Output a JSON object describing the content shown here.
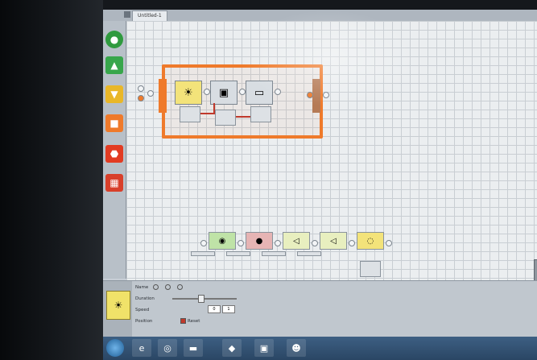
{
  "window": {
    "tab_title": "Untitled-1"
  },
  "palette": {
    "items": [
      {
        "name": "action",
        "color": "#2f9a3e",
        "glyph": "●"
      },
      {
        "name": "flow",
        "color": "#37a64b",
        "glyph": "▲"
      },
      {
        "name": "sensor",
        "color": "#e9b728",
        "glyph": "▼"
      },
      {
        "name": "data",
        "color": "#ef7a2b",
        "glyph": "■"
      },
      {
        "name": "advanced",
        "color": "#e23b22",
        "glyph": "⬣"
      },
      {
        "name": "my-blocks",
        "color": "#d83f2a",
        "glyph": "▦"
      }
    ]
  },
  "loop_program": {
    "blocks": [
      {
        "name": "brightness",
        "glyph": "☀",
        "color": "#f3e37a"
      },
      {
        "name": "display",
        "glyph": "▣",
        "color": "#d8dde2"
      },
      {
        "name": "screen",
        "glyph": "▭",
        "color": "#d8dde2"
      }
    ]
  },
  "sequence": {
    "blocks": [
      {
        "name": "motor",
        "glyph": "◉",
        "color": "#bfe3a7"
      },
      {
        "name": "sound",
        "glyph": "●",
        "color": "#e6b4b4"
      },
      {
        "name": "speaker-1",
        "glyph": "◁",
        "color": "#e8efbf"
      },
      {
        "name": "speaker-2",
        "glyph": "◁",
        "color": "#e8efbf"
      },
      {
        "name": "wait",
        "glyph": "◌",
        "color": "#f3e37a"
      }
    ]
  },
  "properties": {
    "label_name": "Name",
    "label_duration": "Duration",
    "label_speed": "Speed",
    "label_position": "Position",
    "checkbox_label": "Reset",
    "value_1": "0",
    "value_2": "1"
  },
  "taskbar": {
    "apps": [
      {
        "name": "ie",
        "glyph": "e"
      },
      {
        "name": "chrome",
        "glyph": "◎"
      },
      {
        "name": "folder",
        "glyph": "▬"
      },
      {
        "name": "app-green",
        "glyph": "◆"
      },
      {
        "name": "app-red",
        "glyph": "▣"
      },
      {
        "name": "app-panda",
        "glyph": "☻"
      }
    ]
  }
}
